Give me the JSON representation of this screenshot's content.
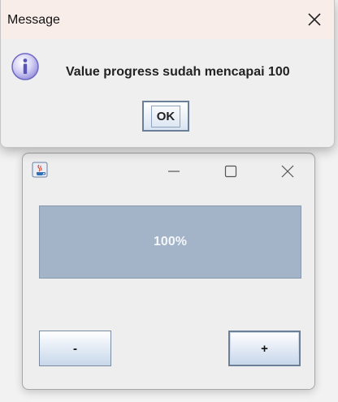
{
  "message_dialog": {
    "title": "Message",
    "text": "Value progress sudah mencapai 100",
    "ok_label": "OK",
    "icon": "info-icon"
  },
  "main_window": {
    "progress": {
      "value": 100,
      "text": "100%"
    },
    "minus_label": "-",
    "plus_label": "+",
    "icons": {
      "app": "java-icon",
      "minimize": "minimize-icon",
      "maximize": "maximize-icon",
      "close": "close-icon"
    }
  },
  "colors": {
    "dialog_titlebar": "#f8ede9",
    "progress_fill": "#a3b4c9",
    "window_bg": "#eeeeee"
  }
}
